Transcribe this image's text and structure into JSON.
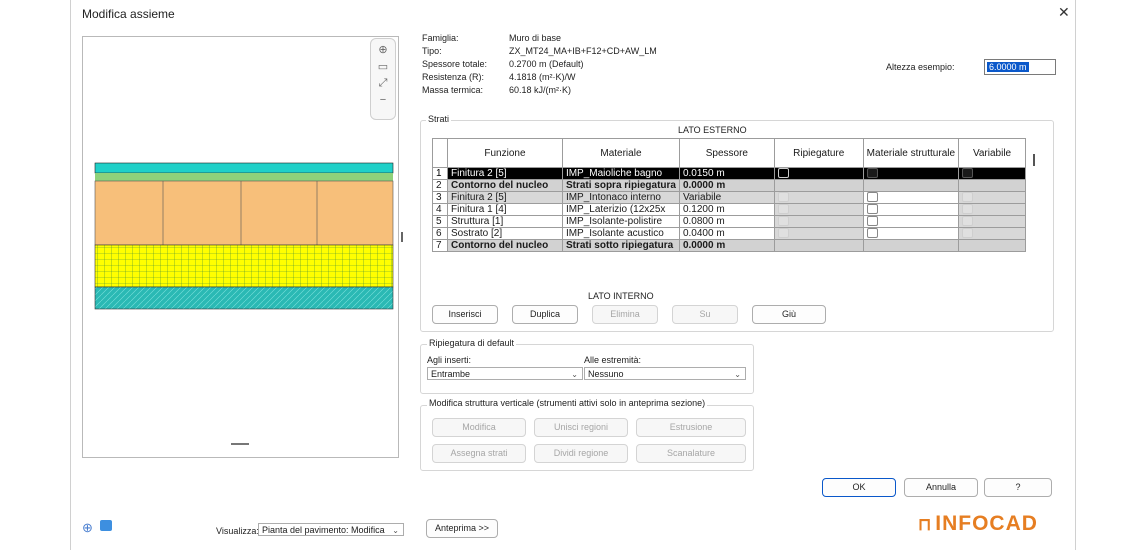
{
  "window": {
    "title": "Modifica assieme",
    "close_icon": "close-icon"
  },
  "properties": {
    "famiglia_label": "Famiglia:",
    "famiglia_value": "Muro di base",
    "tipo_label": "Tipo:",
    "tipo_value": "ZX_MT24_MA+IB+F12+CD+AW_LM",
    "spessore_label": "Spessore totale:",
    "spessore_value": "0.2700 m (Default)",
    "resistenza_label": "Resistenza (R):",
    "resistenza_value": "4.1818 (m²·K)/W",
    "massa_label": "Massa termica:",
    "massa_value": "60.18 kJ/(m²·K)",
    "altezza_label": "Altezza esempio:",
    "altezza_value": "6.0000 m"
  },
  "layers": {
    "group_label": "Strati",
    "top_label": "LATO ESTERNO",
    "bottom_label": "LATO INTERNO",
    "columns": [
      "Funzione",
      "Materiale",
      "Spessore",
      "Ripiegature",
      "Materiale strutturale",
      "Variabile"
    ],
    "rows": [
      {
        "n": "1",
        "funzione": "Finitura 2 [5]",
        "materiale": "IMP_Maioliche bagno",
        "spessore": "0.0150 m"
      },
      {
        "n": "2",
        "funzione": "Contorno del nucleo",
        "materiale": "Strati sopra ripiegatura",
        "spessore": "0.0000 m"
      },
      {
        "n": "3",
        "funzione": "Finitura 2 [5]",
        "materiale": "IMP_Intonaco interno",
        "spessore": "Variabile"
      },
      {
        "n": "4",
        "funzione": "Finitura 1 [4]",
        "materiale": "IMP_Laterizio (12x25x",
        "spessore": "0.1200 m"
      },
      {
        "n": "5",
        "funzione": "Struttura [1]",
        "materiale": "IMP_Isolante-polistire",
        "spessore": "0.0800 m"
      },
      {
        "n": "6",
        "funzione": "Sostrato [2]",
        "materiale": "IMP_Isolante acustico",
        "spessore": "0.0400 m"
      },
      {
        "n": "7",
        "funzione": "Contorno del nucleo",
        "materiale": "Strati sotto ripiegatura",
        "spessore": "0.0000 m"
      }
    ],
    "buttons": {
      "inserisci": "Inserisci",
      "duplica": "Duplica",
      "elimina": "Elimina",
      "su": "Su",
      "giu": "Giù"
    }
  },
  "wrapping": {
    "group_label": "Ripiegatura di default",
    "inserts_label": "Agli inserti:",
    "inserts_value": "Entrambe",
    "ends_label": "Alle estremità:",
    "ends_value": "Nessuno"
  },
  "vertical": {
    "group_label": "Modifica struttura verticale (strumenti attivi solo in anteprima sezione)",
    "modifica": "Modifica",
    "unisci": "Unisci regioni",
    "estrusione": "Estrusione",
    "assegna": "Assegna strati",
    "dividi": "Dividi regione",
    "scanalature": "Scanalature"
  },
  "footer": {
    "ok": "OK",
    "annulla": "Annulla",
    "help": "?",
    "visualizza_label": "Visualizza:",
    "visualizza_value": "Pianta del pavimento: Modifica",
    "anteprima": "Anteprima >>",
    "logo": "INFOCAD"
  },
  "colors": {
    "accent": "#0a58ca",
    "brand": "#e67e22",
    "tile": "#1fd0c8",
    "masonry": "#f7bf7a",
    "insulation": "#ffff00",
    "acoustic": "#2ab9b4"
  }
}
